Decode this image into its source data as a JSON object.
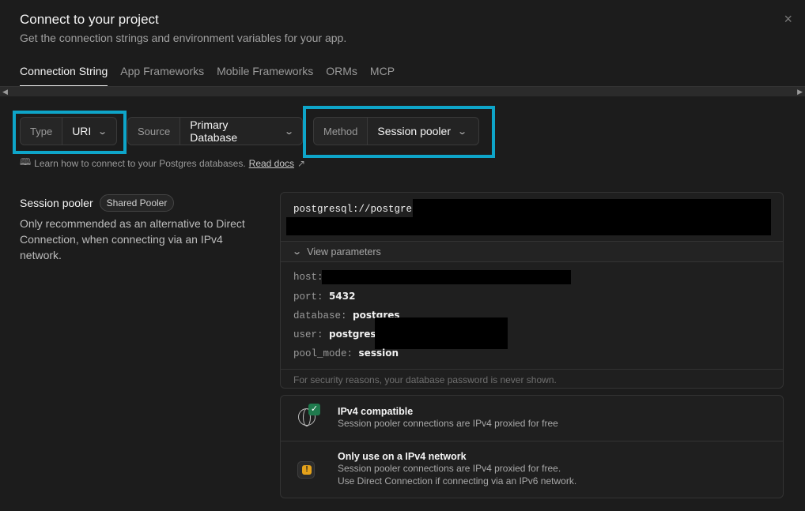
{
  "header": {
    "title": "Connect to your project",
    "subtitle": "Get the connection strings and environment variables for your app.",
    "close_icon": "×"
  },
  "tabs": [
    {
      "label": "Connection String",
      "active": true
    },
    {
      "label": "App Frameworks"
    },
    {
      "label": "Mobile Frameworks"
    },
    {
      "label": "ORMs"
    },
    {
      "label": "MCP"
    }
  ],
  "selectors": {
    "type": {
      "label": "Type",
      "value": "URI"
    },
    "source": {
      "label": "Source",
      "value": "Primary Database"
    },
    "method": {
      "label": "Method",
      "value": "Session pooler"
    }
  },
  "learn": {
    "text": "Learn how to connect to your Postgres databases.",
    "link": "Read docs"
  },
  "left": {
    "title": "Session pooler",
    "badge": "Shared Pooler",
    "description": "Only recommended as an alternative to Direct Connection, when connecting via an IPv4 network."
  },
  "connection": {
    "string_prefix": "postgresql://postgres",
    "view_parameters": "View parameters",
    "params": [
      {
        "key": "host:",
        "value": ""
      },
      {
        "key": "port:",
        "value": "5432"
      },
      {
        "key": "database:",
        "value": "postgres"
      },
      {
        "key": "user:",
        "value": "postgres."
      },
      {
        "key": "pool_mode:",
        "value": "session"
      }
    ],
    "security_note": "For security reasons, your database password is never shown."
  },
  "info": [
    {
      "title": "IPv4 compatible",
      "lines": [
        "Session pooler connections are IPv4 proxied for free"
      ]
    },
    {
      "title": "Only use on a IPv4 network",
      "lines": [
        "Session pooler connections are IPv4 proxied for free.",
        "Use Direct Connection if connecting via an IPv6 network."
      ]
    }
  ],
  "colors": {
    "highlight": "#0ea5c9",
    "ok": "#1f7a4d",
    "warn": "#e5a21a"
  }
}
